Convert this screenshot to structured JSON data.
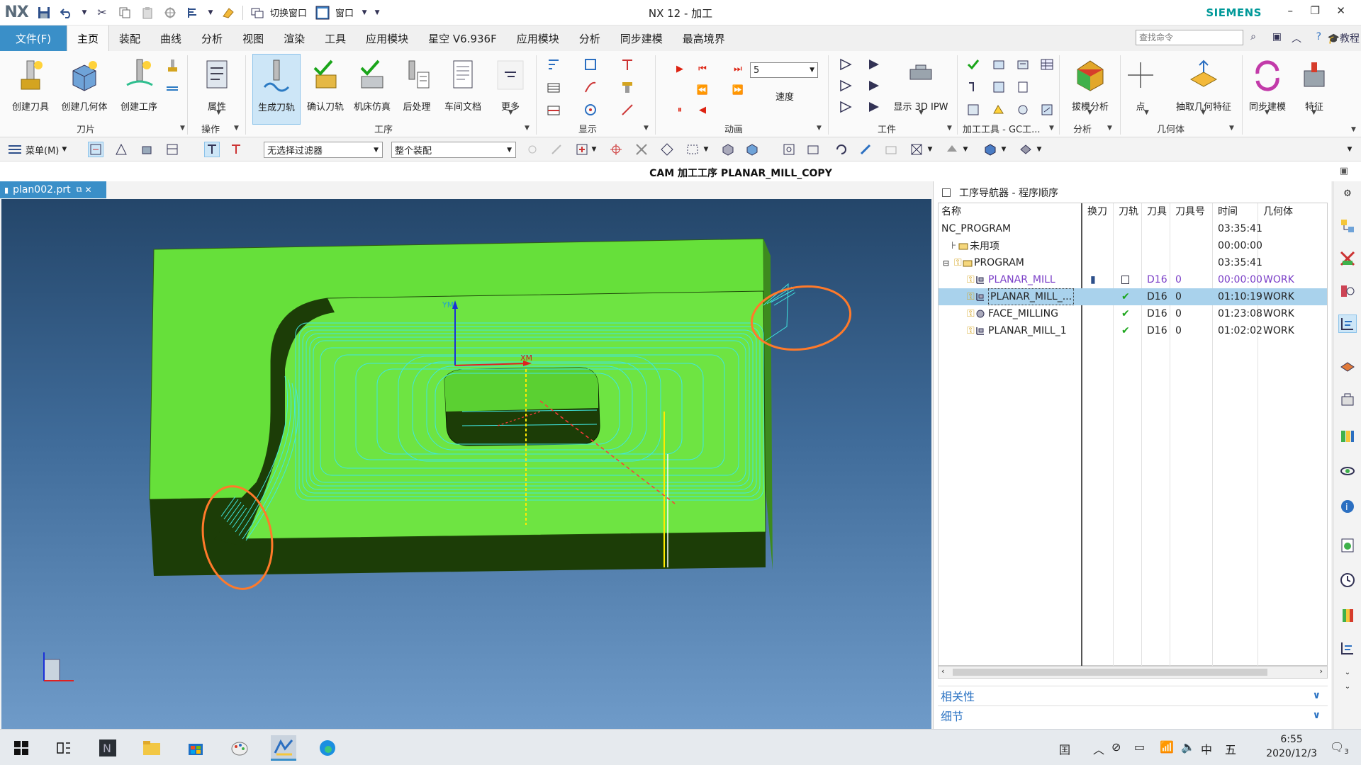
{
  "window": {
    "logo": "NX",
    "title": "NX 12 - 加工",
    "brand": "SIEMENS",
    "quick_access": {
      "switch_window": "切换窗口",
      "window": "窗口"
    }
  },
  "menu": {
    "file": "文件(F)",
    "tabs": [
      "主页",
      "装配",
      "曲线",
      "分析",
      "视图",
      "渲染",
      "工具",
      "应用模块",
      "星空 V6.936F",
      "应用模块",
      "分析",
      "同步建模",
      "最高境界"
    ],
    "search_placeholder": "查找命令",
    "help": "教程"
  },
  "ribbon": {
    "buttons": {
      "create_tool": "创建刀具",
      "create_geometry": "创建几何体",
      "create_operation": "创建工序",
      "properties": "属性",
      "generate_toolpath": "生成刀轨",
      "verify_toolpath": "确认刀轨",
      "machine_sim": "机床仿真",
      "postprocess": "后处理",
      "shop_doc": "车间文档",
      "more": "更多",
      "speed": "速度",
      "show_3d_ipw": "显示 3D IPW",
      "draft_analysis": "拔模分析",
      "point": "点",
      "extract_geometry": "抽取几何特征",
      "sync_modeling": "同步建模",
      "feature": "特征"
    },
    "speed_value": "5",
    "groups": {
      "insert": "刀片",
      "operations": "操作",
      "operation": "工序",
      "display": "显示",
      "animation": "动画",
      "workpiece": "工件",
      "machining_tools": "加工工具 - GC工...",
      "analysis": "分析",
      "geometry": "几何体"
    }
  },
  "toolbar2": {
    "menu": "菜单(M)",
    "filter": "无选择过滤器",
    "assembly": "整个装配"
  },
  "cam_header": "CAM 加工工序 PLANAR_MILL_COPY",
  "doc_tab": "plan002.prt",
  "viewport": {
    "wcs_y": "YM",
    "wcs_x": "XM"
  },
  "navigator": {
    "title": "工序导航器 - 程序顺序",
    "columns": [
      "名称",
      "换刀",
      "刀轨",
      "刀具",
      "刀具号",
      "时间",
      "几何体"
    ],
    "rows": [
      {
        "name": "NC_PROGRAM",
        "time": "03:35:41",
        "tool": "",
        "tool_no": "",
        "geometry": ""
      },
      {
        "name": "未用项",
        "time": "00:00:00",
        "tool": "",
        "tool_no": "",
        "geometry": ""
      },
      {
        "name": "PROGRAM",
        "time": "03:35:41",
        "tool": "",
        "tool_no": "",
        "geometry": ""
      },
      {
        "name": "PLANAR_MILL",
        "tool": "D16",
        "tool_no": "0",
        "time": "00:00:00",
        "geometry": "WORK"
      },
      {
        "name": "PLANAR_MILL_...",
        "tool": "D16",
        "tool_no": "0",
        "time": "01:10:19",
        "geometry": "WORK"
      },
      {
        "name": "FACE_MILLING",
        "tool": "D16",
        "tool_no": "0",
        "time": "01:23:08",
        "geometry": "WORK"
      },
      {
        "name": "PLANAR_MILL_1",
        "tool": "D16",
        "tool_no": "0",
        "time": "01:02:02",
        "geometry": "WORK"
      }
    ],
    "sections": {
      "dependencies": "相关性",
      "details": "细节"
    }
  },
  "taskbar": {
    "tray_input": "中",
    "tray_ime": "五",
    "time": "6:55",
    "date": "2020/12/3",
    "notifications": "3"
  },
  "colors": {
    "file_tab": "#3a8fc8",
    "brand": "#009999",
    "part_green": "#66e03a",
    "toolpath_cyan": "#40e6e0",
    "selected_row": "#a9d2ec",
    "highlight_ring": "#ff7a2a"
  }
}
